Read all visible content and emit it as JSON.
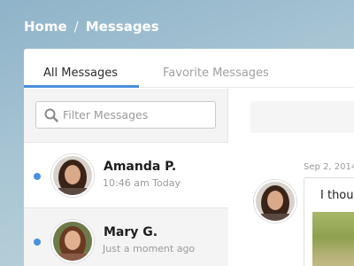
{
  "breadcrumb": {
    "home": "Home",
    "separator": "/",
    "current": "Messages"
  },
  "tabs": [
    {
      "label": "All Messages",
      "active": true
    },
    {
      "label": "Favorite Messages",
      "active": false
    }
  ],
  "filter": {
    "placeholder": "Filter Messages",
    "value": ""
  },
  "conversations": [
    {
      "name": "Amanda P.",
      "time": "10:46 am Today",
      "unread": true,
      "selected": false
    },
    {
      "name": "Mary G.",
      "time": "Just a moment ago",
      "unread": true,
      "selected": true
    }
  ],
  "thread": {
    "date": "Sep 2, 2014",
    "message_text": "I thou"
  },
  "colors": {
    "accent": "#4a8fdc",
    "unread_dot": "#4a90e2",
    "breadcrumb_text": "#ffffff"
  },
  "icons": {
    "filter": "search-icon"
  }
}
